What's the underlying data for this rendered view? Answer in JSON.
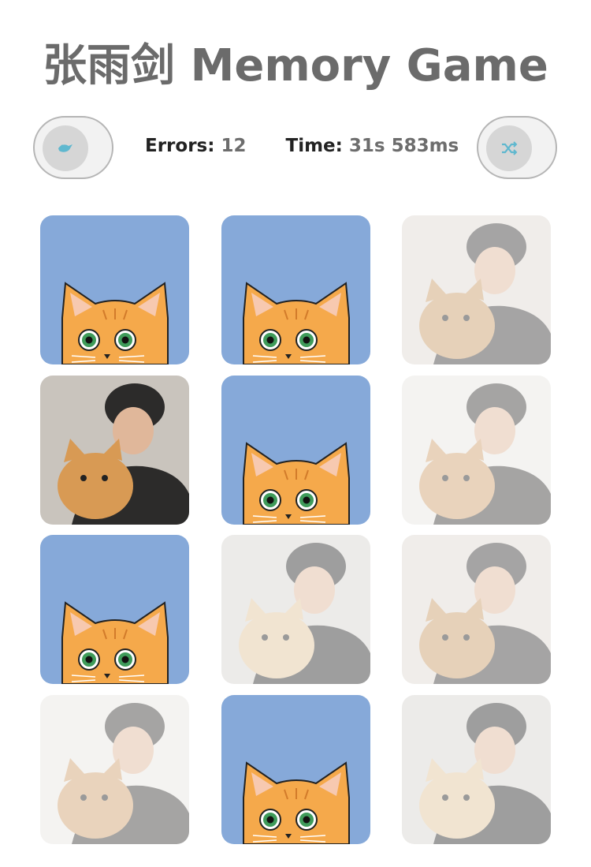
{
  "app": {
    "title": "张雨剑 Memory Game"
  },
  "toolbar": {
    "left_toggle_icon": "bird-icon",
    "right_toggle_icon": "shuffle-icon",
    "errors_label": "Errors:",
    "errors_value": "12",
    "time_label": "Time:",
    "time_value": "31s 583ms",
    "accent_color": "#5fb8cf"
  },
  "board": {
    "columns": 3,
    "rows": 4,
    "card_back_color": "#86a9d9",
    "cards": [
      {
        "state": "face-down",
        "content": "cat-card-back"
      },
      {
        "state": "face-down",
        "content": "cat-card-back"
      },
      {
        "state": "matched",
        "content": "photo-man-with-cat-looking-up"
      },
      {
        "state": "face-up",
        "content": "photo-man-lying-with-cat"
      },
      {
        "state": "face-down",
        "content": "cat-card-back"
      },
      {
        "state": "matched",
        "content": "photo-man-kissing-cat"
      },
      {
        "state": "face-down",
        "content": "cat-card-back"
      },
      {
        "state": "matched",
        "content": "photo-man-hugging-cat"
      },
      {
        "state": "matched",
        "content": "photo-man-with-cat-looking-up"
      },
      {
        "state": "matched",
        "content": "photo-man-kissing-cat"
      },
      {
        "state": "face-down",
        "content": "cat-card-back"
      },
      {
        "state": "matched",
        "content": "photo-man-hugging-cat"
      }
    ]
  }
}
